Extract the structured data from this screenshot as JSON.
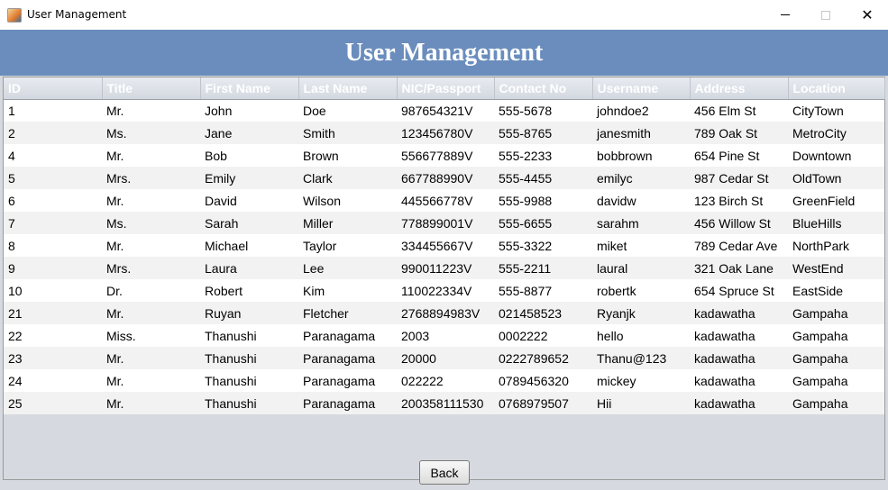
{
  "window": {
    "title": "User Management",
    "icon": "java-cup-icon"
  },
  "banner": {
    "title": "User Management"
  },
  "table": {
    "columns": [
      "ID",
      "Title",
      "First Name",
      "Last Name",
      "NIC/Passport",
      "Contact No",
      "Username",
      "Address",
      "Location"
    ],
    "rows": [
      [
        "1",
        "Mr.",
        "John",
        "Doe",
        "987654321V",
        "555-5678",
        "johndoe2",
        "456 Elm St",
        "CityTown"
      ],
      [
        "2",
        "Ms.",
        "Jane",
        "Smith",
        "123456780V",
        "555-8765",
        "janesmith",
        "789 Oak St",
        "MetroCity"
      ],
      [
        "4",
        "Mr.",
        "Bob",
        "Brown",
        "556677889V",
        "555-2233",
        "bobbrown",
        "654 Pine St",
        "Downtown"
      ],
      [
        "5",
        "Mrs.",
        "Emily",
        "Clark",
        "667788990V",
        "555-4455",
        "emilyc",
        "987 Cedar St",
        "OldTown"
      ],
      [
        "6",
        "Mr.",
        "David",
        "Wilson",
        "445566778V",
        "555-9988",
        "davidw",
        "123 Birch St",
        "GreenField"
      ],
      [
        "7",
        "Ms.",
        "Sarah",
        "Miller",
        "778899001V",
        "555-6655",
        "sarahm",
        "456 Willow St",
        "BlueHills"
      ],
      [
        "8",
        "Mr.",
        "Michael",
        "Taylor",
        "334455667V",
        "555-3322",
        "miket",
        "789 Cedar Ave",
        "NorthPark"
      ],
      [
        "9",
        "Mrs.",
        "Laura",
        "Lee",
        "990011223V",
        "555-2211",
        "laural",
        "321 Oak Lane",
        "WestEnd"
      ],
      [
        "10",
        "Dr.",
        "Robert",
        "Kim",
        "110022334V",
        "555-8877",
        "robertk",
        "654 Spruce St",
        "EastSide"
      ],
      [
        "21",
        "Mr.",
        "Ruyan",
        "Fletcher",
        "2768894983V",
        "021458523",
        "Ryanjk",
        "kadawatha",
        "Gampaha"
      ],
      [
        "22",
        "Miss.",
        "Thanushi",
        "Paranagama",
        "2003",
        "0002222",
        "hello",
        "kadawatha",
        "Gampaha"
      ],
      [
        "23",
        "Mr.",
        "Thanushi",
        "Paranagama",
        "20000",
        "0222789652",
        "Thanu@123",
        "kadawatha",
        "Gampaha"
      ],
      [
        "24",
        "Mr.",
        "Thanushi",
        "Paranagama",
        "022222",
        "0789456320",
        "mickey",
        "kadawatha",
        "Gampaha"
      ],
      [
        "25",
        "Mr.",
        "Thanushi",
        "Paranagama",
        "200358111530",
        "0768979507",
        "Hii",
        "kadawatha",
        "Gampaha"
      ]
    ]
  },
  "footer": {
    "back_label": "Back"
  }
}
